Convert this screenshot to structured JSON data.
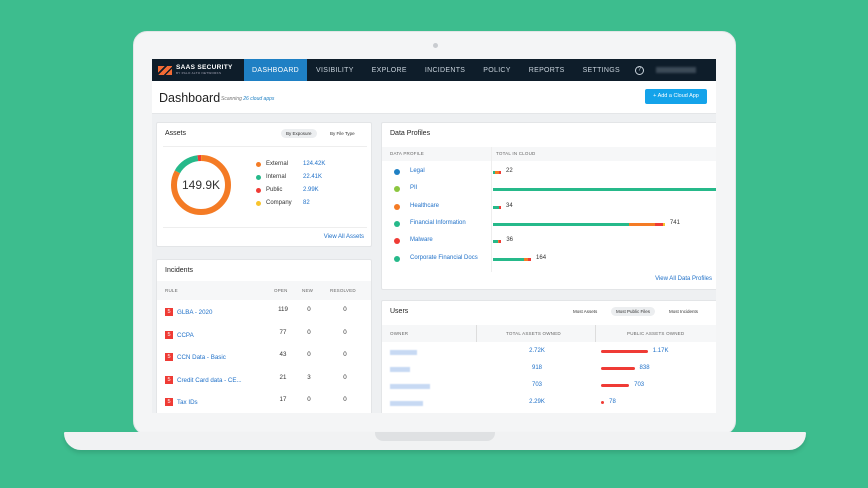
{
  "nav": {
    "brand": "SAAS SECURITY",
    "brand_sub": "BY PALO ALTO NETWORKS",
    "items": [
      "DASHBOARD",
      "VISIBILITY",
      "EXPLORE",
      "INCIDENTS",
      "POLICY",
      "REPORTS",
      "SETTINGS"
    ],
    "active": "DASHBOARD",
    "help": "?"
  },
  "header": {
    "title": "Dashboard",
    "scan_prefix": "Scanning",
    "scan_link": "26 cloud apps",
    "add_button": "+ Add a Cloud App"
  },
  "assets": {
    "title": "Assets",
    "tabs": [
      "By Exposure",
      "By File Type"
    ],
    "active_tab": "By Exposure",
    "total": "149.9K",
    "legend": [
      {
        "label": "External",
        "value": "124.42K",
        "color": "#f47b25"
      },
      {
        "label": "Internal",
        "value": "22.41K",
        "color": "#26b98a"
      },
      {
        "label": "Public",
        "value": "2.99K",
        "color": "#ef3b35"
      },
      {
        "label": "Company",
        "value": "82",
        "color": "#f8c42c"
      }
    ],
    "view_all": "View All Assets"
  },
  "incidents": {
    "title": "Incidents",
    "columns": [
      "RULE",
      "OPEN",
      "NEW",
      "RESOLVED"
    ],
    "rows": [
      {
        "severity": "5",
        "rule": "GLBA - 2020",
        "open": "119",
        "new": "0",
        "resolved": "0"
      },
      {
        "severity": "5",
        "rule": "CCPA",
        "open": "77",
        "new": "0",
        "resolved": "0"
      },
      {
        "severity": "5",
        "rule": "CCN Data - Basic",
        "open": "43",
        "new": "0",
        "resolved": "0"
      },
      {
        "severity": "5",
        "rule": "Credit Card data - CE...",
        "open": "21",
        "new": "3",
        "resolved": "0"
      },
      {
        "severity": "5",
        "rule": "Tax IDs",
        "open": "17",
        "new": "0",
        "resolved": "0"
      }
    ]
  },
  "data_profiles": {
    "title": "Data Profiles",
    "columns": [
      "DATA PROFILE",
      "TOTAL IN CLOUD"
    ],
    "view_all": "View All Data Profiles",
    "rows": [
      {
        "name": "Legal",
        "total": "22",
        "icon_color": "#1f80c4",
        "segments": [
          {
            "color": "#26b98a",
            "share": 0.3
          },
          {
            "color": "#f47b25",
            "share": 0.5
          },
          {
            "color": "#ef3b35",
            "share": 0.2
          }
        ]
      },
      {
        "name": "PII",
        "total": "",
        "icon_color": "#8cc63f",
        "segments": [
          {
            "color": "#26b98a",
            "share": 1
          }
        ]
      },
      {
        "name": "Healthcare",
        "total": "34",
        "icon_color": "#f47b25",
        "segments": [
          {
            "color": "#26b98a",
            "share": 0.8
          },
          {
            "color": "#ef3b35",
            "share": 0.2
          }
        ]
      },
      {
        "name": "Financial Information",
        "total": "741",
        "icon_color": "#26b98a",
        "segments": [
          {
            "color": "#26b98a",
            "share": 0.79
          },
          {
            "color": "#f47b25",
            "share": 0.15
          },
          {
            "color": "#ef3b35",
            "share": 0.05
          },
          {
            "color": "#f8c42c",
            "share": 0.01
          }
        ]
      },
      {
        "name": "Malware",
        "total": "36",
        "icon_color": "#ef3b35",
        "segments": [
          {
            "color": "#26b98a",
            "share": 0.55
          },
          {
            "color": "#f47b25",
            "share": 0.2
          },
          {
            "color": "#ef3b35",
            "share": 0.25
          }
        ]
      },
      {
        "name": "Corporate Financial Docs",
        "total": "164",
        "icon_color": "#26b98a",
        "segments": [
          {
            "color": "#26b98a",
            "share": 0.82
          },
          {
            "color": "#f47b25",
            "share": 0.1
          },
          {
            "color": "#ef3b35",
            "share": 0.08
          }
        ]
      }
    ]
  },
  "users": {
    "title": "Users",
    "tabs": [
      "Most Assets",
      "Most Public Files",
      "Most Incidents"
    ],
    "active_tab": "Most Public Files",
    "columns": [
      "OWNER",
      "TOTAL ASSETS OWNED",
      "PUBLIC ASSETS OWNED"
    ],
    "rows": [
      {
        "total": "2.72K",
        "public": "1.17K",
        "public_num": 1170
      },
      {
        "total": "918",
        "public": "838",
        "public_num": 838
      },
      {
        "total": "703",
        "public": "703",
        "public_num": 703
      },
      {
        "total": "2.29K",
        "public": "78",
        "public_num": 78
      }
    ]
  },
  "colors": {
    "accent": "#1f80c4",
    "nav_bg": "#0e1d2a",
    "background": "#3dbd8e",
    "button": "#14a3ea"
  }
}
